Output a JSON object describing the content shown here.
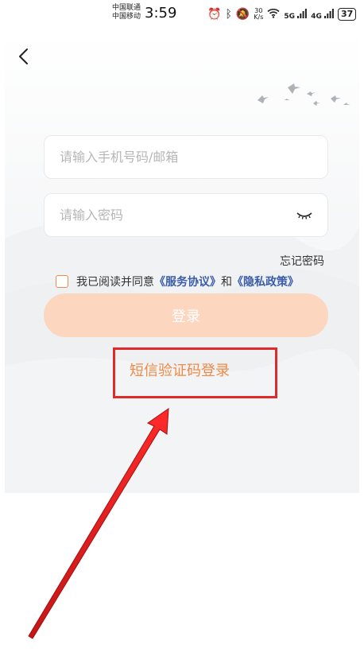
{
  "status_bar": {
    "carrier_1": "中国联通",
    "carrier_2": "中国移动",
    "time": "3:59",
    "speed_value": "30",
    "speed_unit": "K/s",
    "net_5g": "5G",
    "net_4g": "4G",
    "battery": "37"
  },
  "login": {
    "account_placeholder": "请输入手机号码/邮箱",
    "password_placeholder": "请输入密码",
    "forgot_password": "忘记密码",
    "agreement_prefix": "我已阅读并同意",
    "service_agreement": "《服务协议》",
    "agreement_and": "和",
    "privacy_policy": "《隐私政策》",
    "login_button": "登录",
    "sms_login": "短信验证码登录"
  },
  "colors": {
    "accent_orange": "#ef8a45",
    "login_button_disabled": "#fcd6bf",
    "link_blue": "#3a5ca8",
    "annotation_red": "#e02a2a"
  }
}
